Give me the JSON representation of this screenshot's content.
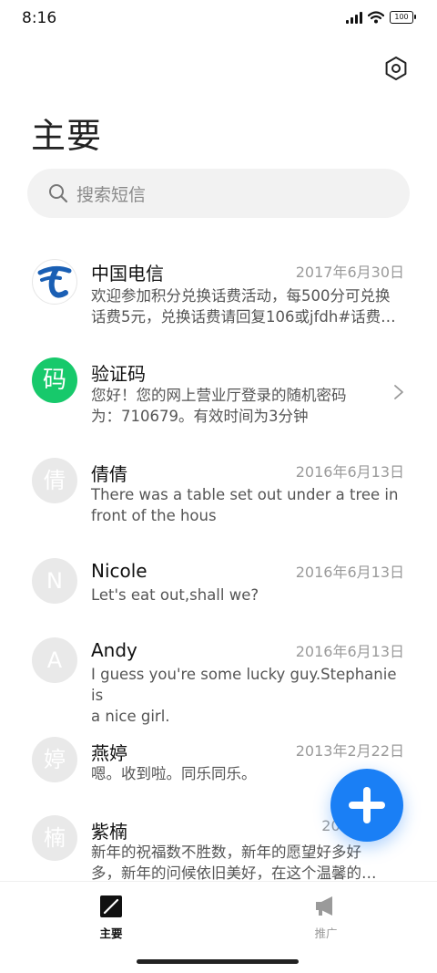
{
  "status_bar": {
    "time": "8:16",
    "battery": "100"
  },
  "header": {
    "title": "主要"
  },
  "search": {
    "placeholder": "搜索短信"
  },
  "messages": [
    {
      "name": "中国电信",
      "date": "2017年6月30日",
      "preview_line1": "欢迎参加积分兑换话费活动，每500分可兑换",
      "preview_line2": "话费5元，兑换话费请回复106或jfdh#话费…",
      "avatar": "china-telecom-logo"
    },
    {
      "name": "验证码",
      "date": "",
      "preview_line1": "您好！您的网上营业厅登录的随机密码",
      "preview_line2": "为：710679。有效时间为3分钟",
      "avatar_text": "码",
      "avatar_color": "#17c96b"
    },
    {
      "name": "倩倩",
      "date": "2016年6月13日",
      "preview_line1": "There was a table set out under a tree in",
      "preview_line2": "front of the hous",
      "avatar_text": "倩"
    },
    {
      "name": "Nicole",
      "date": "2016年6月13日",
      "preview_line1": "Let's eat out,shall we?",
      "preview_line2": "",
      "avatar_text": "N"
    },
    {
      "name": "Andy",
      "date": "2016年6月13日",
      "preview_line1": "I guess you're some lucky guy.Stephanie is",
      "preview_line2": "a nice girl.",
      "avatar_text": "A"
    },
    {
      "name": "燕婷",
      "date": "2013年2月22日",
      "preview_line1": "嗯。收到啦。同乐同乐。",
      "preview_line2": "",
      "avatar_text": "婷"
    },
    {
      "name": "紫楠",
      "date": "2013",
      "preview_line1": "新年的祝福数不胜数，新年的愿望好多好",
      "preview_line2": "多，新年的问候依旧美好，在这个温馨的…",
      "avatar_text": "楠"
    }
  ],
  "bottom_nav": [
    {
      "label": "主要",
      "icon": "compose-icon",
      "active": true
    },
    {
      "label": "推广",
      "icon": "megaphone-icon",
      "active": false
    }
  ],
  "colors": {
    "accent": "#1a7ff5",
    "verify_green": "#17c96b",
    "telecom_blue": "#1a5fb4"
  }
}
